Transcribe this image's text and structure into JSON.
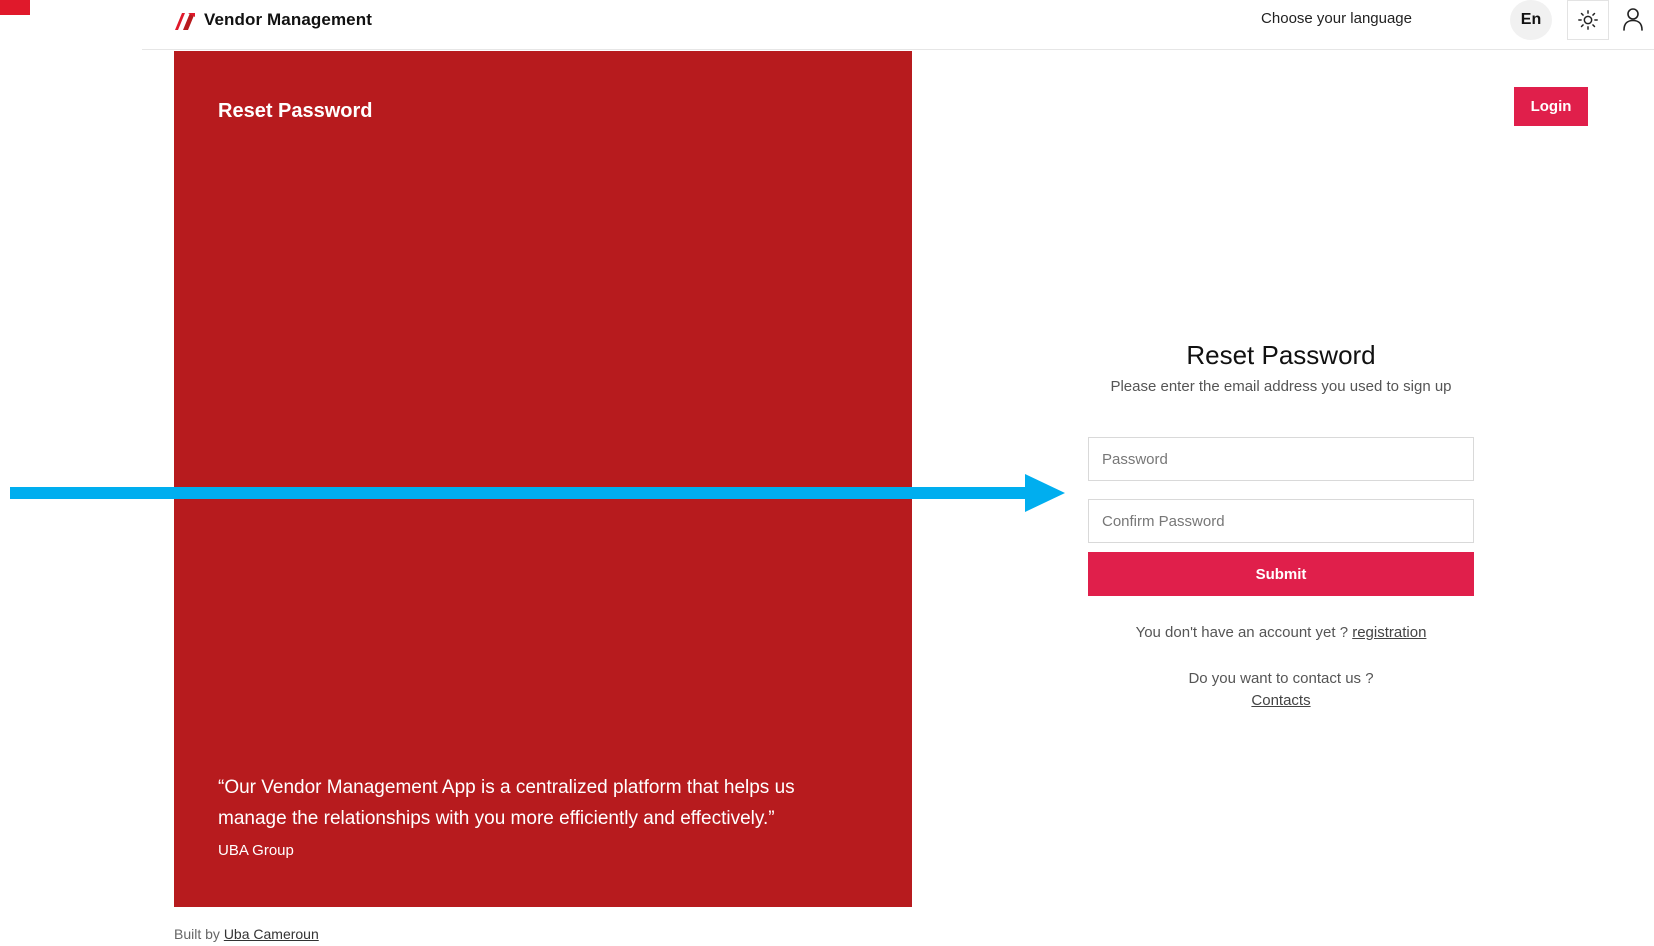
{
  "header": {
    "app_name": "Vendor Management",
    "language_label": "Choose your language",
    "language_code": "En",
    "icons": {
      "logo": "brand-logo",
      "theme": "sun-icon",
      "user": "user-icon"
    }
  },
  "hero": {
    "title": "Reset Password",
    "quote": "“Our Vendor Management App is a centralized platform that helps us manage the relationships with you more efficiently and effectively.”",
    "author": "UBA Group"
  },
  "footer": {
    "prefix": "Built by",
    "link_text": "Uba Cameroun"
  },
  "auth": {
    "login_label": "Login"
  },
  "form": {
    "title": "Reset Password",
    "subtitle": "Please enter the email address you used to sign up",
    "password_placeholder": "Password",
    "password_value": "",
    "confirm_placeholder": "Confirm Password",
    "confirm_value": "",
    "submit_label": "Submit",
    "signup_prompt": "You don't have an account yet ?",
    "signup_link": "registration",
    "contact_prompt": "Do you want to contact us ?",
    "contact_link": "Contacts"
  },
  "colors": {
    "hero_background": "#b71b1e",
    "accent": "#e01f4b",
    "annotation_arrow": "#00aeef"
  }
}
